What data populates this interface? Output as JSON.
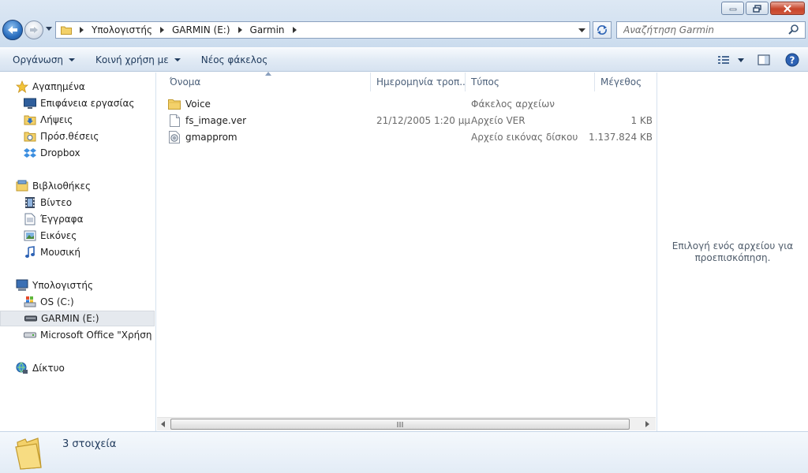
{
  "address_bar": {
    "crumbs": [
      "Υπολογιστής",
      "GARMIN (E:)",
      "Garmin"
    ]
  },
  "search": {
    "placeholder": "Αναζήτηση Garmin"
  },
  "toolbar": {
    "organize": "Οργάνωση",
    "share": "Κοινή χρήση με",
    "new_folder": "Νέος φάκελος"
  },
  "navigation": {
    "favorites": {
      "label": "Αγαπημένα",
      "items": [
        "Επιφάνεια εργασίας",
        "Λήψεις",
        "Πρόσ.θέσεις",
        "Dropbox"
      ]
    },
    "libraries": {
      "label": "Βιβλιοθήκες",
      "items": [
        "Βίντεο",
        "Έγγραφα",
        "Εικόνες",
        "Μουσική"
      ]
    },
    "computer": {
      "label": "Υπολογιστής",
      "items": [
        "OS (C:)",
        "GARMIN (E:)",
        "Microsoft Office \"Χρήση με"
      ]
    },
    "network": {
      "label": "Δίκτυο"
    }
  },
  "columns": {
    "name": "Όνομα",
    "date": "Ημερομηνία τροπ...",
    "type": "Τύπος",
    "size": "Μέγεθος"
  },
  "files": [
    {
      "name": "Voice",
      "date": "",
      "type": "Φάκελος αρχείων",
      "size": "",
      "icon": "folder-icon"
    },
    {
      "name": "fs_image.ver",
      "date": "21/12/2005 1:20 μμ",
      "type": "Αρχείο VER",
      "size": "1 KB",
      "icon": "file-icon"
    },
    {
      "name": "gmapprom",
      "date": "",
      "type": "Αρχείο εικόνας δίσκου",
      "size": "1.137.824 KB",
      "icon": "disc-image-icon"
    }
  ],
  "preview": {
    "message": "Επιλογή ενός αρχείου για προεπισκόπηση."
  },
  "details": {
    "count": "3 στοιχεία"
  },
  "colors": {
    "accent": "#1e395b",
    "selection": "#e5e9ee",
    "toolbar": "#dde8f4",
    "folder": "#f3d16a"
  }
}
